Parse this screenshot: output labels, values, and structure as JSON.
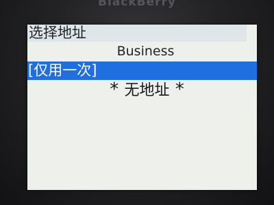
{
  "device": {
    "brand": "BlackBerry"
  },
  "screen": {
    "title": "选择地址",
    "subtitle": "Business",
    "options": [
      {
        "label": "[仅用一次]",
        "selected": true
      },
      {
        "label": "无地址",
        "prefix": "*",
        "suffix": "*",
        "selected": false
      }
    ]
  },
  "colors": {
    "selection": "#1f6fe0",
    "screen_bg": "#eef0ec",
    "title_bg": "#dfe6ea"
  }
}
